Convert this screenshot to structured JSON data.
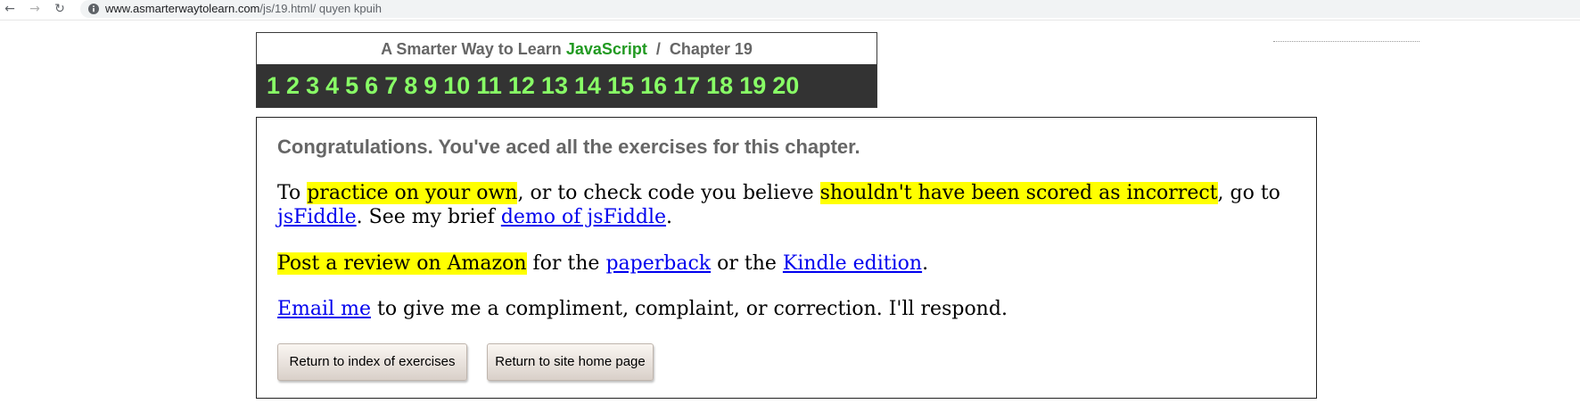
{
  "browser": {
    "url_domain": "www.asmarterwaytolearn.com",
    "url_path": "/js/19.html/ quyen kpuih",
    "back_icon": "←",
    "forward_icon": "→",
    "reload_icon": "↻"
  },
  "header": {
    "title_prefix": "A Smarter Way to Learn ",
    "title_js": "JavaScript",
    "title_suffix": "  /  Chapter 19"
  },
  "chapters": [
    "1",
    "2",
    "3",
    "4",
    "5",
    "6",
    "7",
    "8",
    "9",
    "10",
    "11",
    "12",
    "13",
    "14",
    "15",
    "16",
    "17",
    "18",
    "19",
    "20"
  ],
  "main": {
    "congrats": "Congratulations. You've aced all the exercises for this chapter.",
    "p1": {
      "t1": "To ",
      "h1": "practice on your own",
      "t2": ", or to check code you believe ",
      "h2": "shouldn't have been scored as incorrect",
      "t3": ", go to",
      "link_jsfiddle": "jsFiddle",
      "t4": ". See my brief ",
      "link_demo": "demo of jsFiddle",
      "t5": "."
    },
    "p2": {
      "h1": "Post a review on Amazon",
      "t1": " for the ",
      "link_paperback": "paperback",
      "t2": " or the ",
      "link_kindle": "Kindle edition",
      "t3": "."
    },
    "p3": {
      "link_email": "Email me",
      "t1": " to give me a compliment, complaint, or correction. I'll respond."
    },
    "buttons": {
      "index": "Return to index of exercises",
      "home": "Return to site home page"
    }
  }
}
